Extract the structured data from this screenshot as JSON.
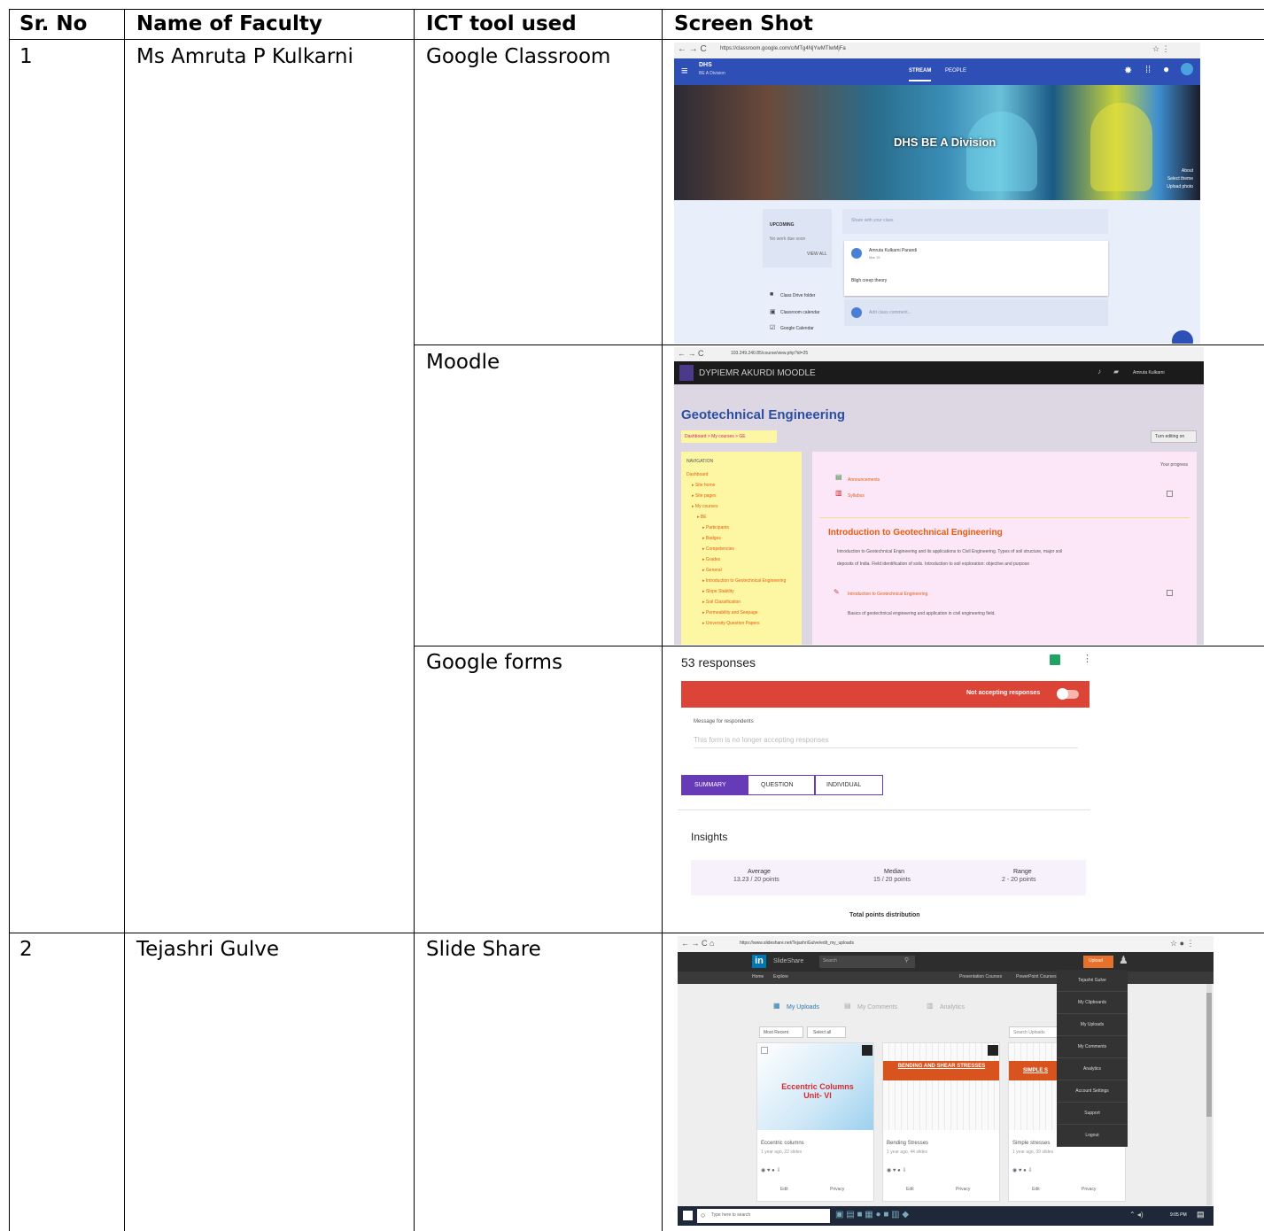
{
  "headers": {
    "sr": "Sr. No",
    "name": "Name of Faculty",
    "ict": "ICT tool used",
    "shot": "Screen Shot"
  },
  "rows": [
    {
      "sr": "1",
      "name": "Ms Amruta P Kulkarni"
    },
    {
      "sr": "2",
      "name": "Tejashri Gulve"
    }
  ],
  "tools": {
    "classroom": "Google Classroom",
    "moodle": "Moodle",
    "forms": "Google forms",
    "slideshare": "Slide Share"
  },
  "classroom": {
    "url": "https://classroom.google.com/c/MTg4NjYwMTIwMjFa",
    "class_short": "DHS",
    "class_sub": "BE A Division",
    "tab_stream": "STREAM",
    "tab_people": "PEOPLE",
    "banner_title": "DHS BE A Division",
    "banner_links": [
      "About",
      "Select theme",
      "Upload photo"
    ],
    "upcoming": "UPCOMING",
    "no_work": "No work due soon",
    "view_all": "VIEW ALL",
    "share_placeholder": "Share with your class",
    "post_author": "Amruta Kulkarni Parandi",
    "post_date": "Mar 15",
    "post_text": "Bligh creep theory",
    "side_links": [
      "Class Drive folder",
      "Classroom calendar",
      "Google Calendar"
    ],
    "add_comment": "Add class comment...",
    "colors": {
      "header": "#2d4fb6",
      "page": "#e8eefa"
    }
  },
  "moodle": {
    "url": "103.249.240.85/course/view.php?id=25",
    "site": "DYPIEMR AKURDI MOODLE",
    "user": "Amruta Kulkarni",
    "course": "Geotechnical Engineering",
    "breadcrumb": "Dashboard > My courses > GE",
    "edit_btn": "Turn editing on",
    "nav_title": "NAVIGATION",
    "nav_items": [
      "Dashboard",
      "Site home",
      "Site pages",
      "My courses",
      "BE",
      "Participants",
      "Badges",
      "Competencies",
      "Grades",
      "General",
      "Introduction to Geotechnical Engineering",
      "Slope Stability",
      "Soil Classification",
      "Permeability and Seepage",
      "University Question Papers"
    ],
    "progress": "Your progress",
    "res1": "Announcements",
    "res2": "Syllabus",
    "section_title": "Introduction to Geotechnical Engineering",
    "section_text": "Introduction to Geotechnical Engineering and its applications to Civil Engineering. Types of soil structure, major soil deposits of India. Field identification of soils. Introduction to soil exploration: objective and purpose",
    "res3": "Introduction to Geotechnical Engineering",
    "res3_desc": "Basics of geotechnical engineering and application in civil engineering field.",
    "colors": {
      "topbar": "#1b1b1b",
      "nav": "#fdf6a3",
      "content": "#fbe7f7",
      "title": "#2c4fa3",
      "accent": "#e85c0d"
    }
  },
  "forms": {
    "responses": "53 responses",
    "not_accepting": "Not accepting responses",
    "msg_label": "Message for respondents",
    "msg_text": "This form is no longer accepting responses",
    "tabs": [
      "SUMMARY",
      "QUESTION",
      "INDIVIDUAL"
    ],
    "insights": "Insights",
    "stats": [
      {
        "label": "Average",
        "value": "13.23 / 20 points"
      },
      {
        "label": "Median",
        "value": "15 / 20 points"
      },
      {
        "label": "Range",
        "value": "2 - 20 points"
      }
    ],
    "dist": "Total points distribution",
    "colors": {
      "bar": "#db4437",
      "tab": "#673ab7"
    }
  },
  "slideshare": {
    "url": "https://www.slideshare.net/TejashriGulve/edit_my_uploads",
    "brand": "SlideShare",
    "search": "Search",
    "upload": "Upload",
    "subnav": [
      "Home",
      "Explore"
    ],
    "subnav_right": [
      "Presentation Courses",
      "PowerPoint Courses"
    ],
    "tabs": [
      "My Uploads",
      "My Comments",
      "Analytics"
    ],
    "sort": "Most Recent",
    "select": "Select all",
    "search_uploads": "Search Uploads",
    "menu": [
      "Tejashri Gulve",
      "My Clipboards",
      "My Uploads",
      "My Comments",
      "Analytics",
      "Account Settings",
      "Support",
      "Logout"
    ],
    "slides": [
      {
        "cover": "Eccentric Columns Unit- VI",
        "title": "Eccentric columns",
        "meta": "1 year ago, 22 slides"
      },
      {
        "cover": "BENDING AND SHEAR STRESSES",
        "title": "Bending Stresses",
        "meta": "1 year ago, 44 slides"
      },
      {
        "cover": "SIMPLE S",
        "title": "Simple stresses",
        "meta": "1 year ago, 39 slides"
      }
    ],
    "edit": "Edit",
    "privacy": "Privacy",
    "taskbar_search": "Type here to search",
    "clock": "9:05 PM",
    "colors": {
      "topbar": "#2d2d2d",
      "accent": "#e7712a",
      "menu": "#333333"
    }
  }
}
